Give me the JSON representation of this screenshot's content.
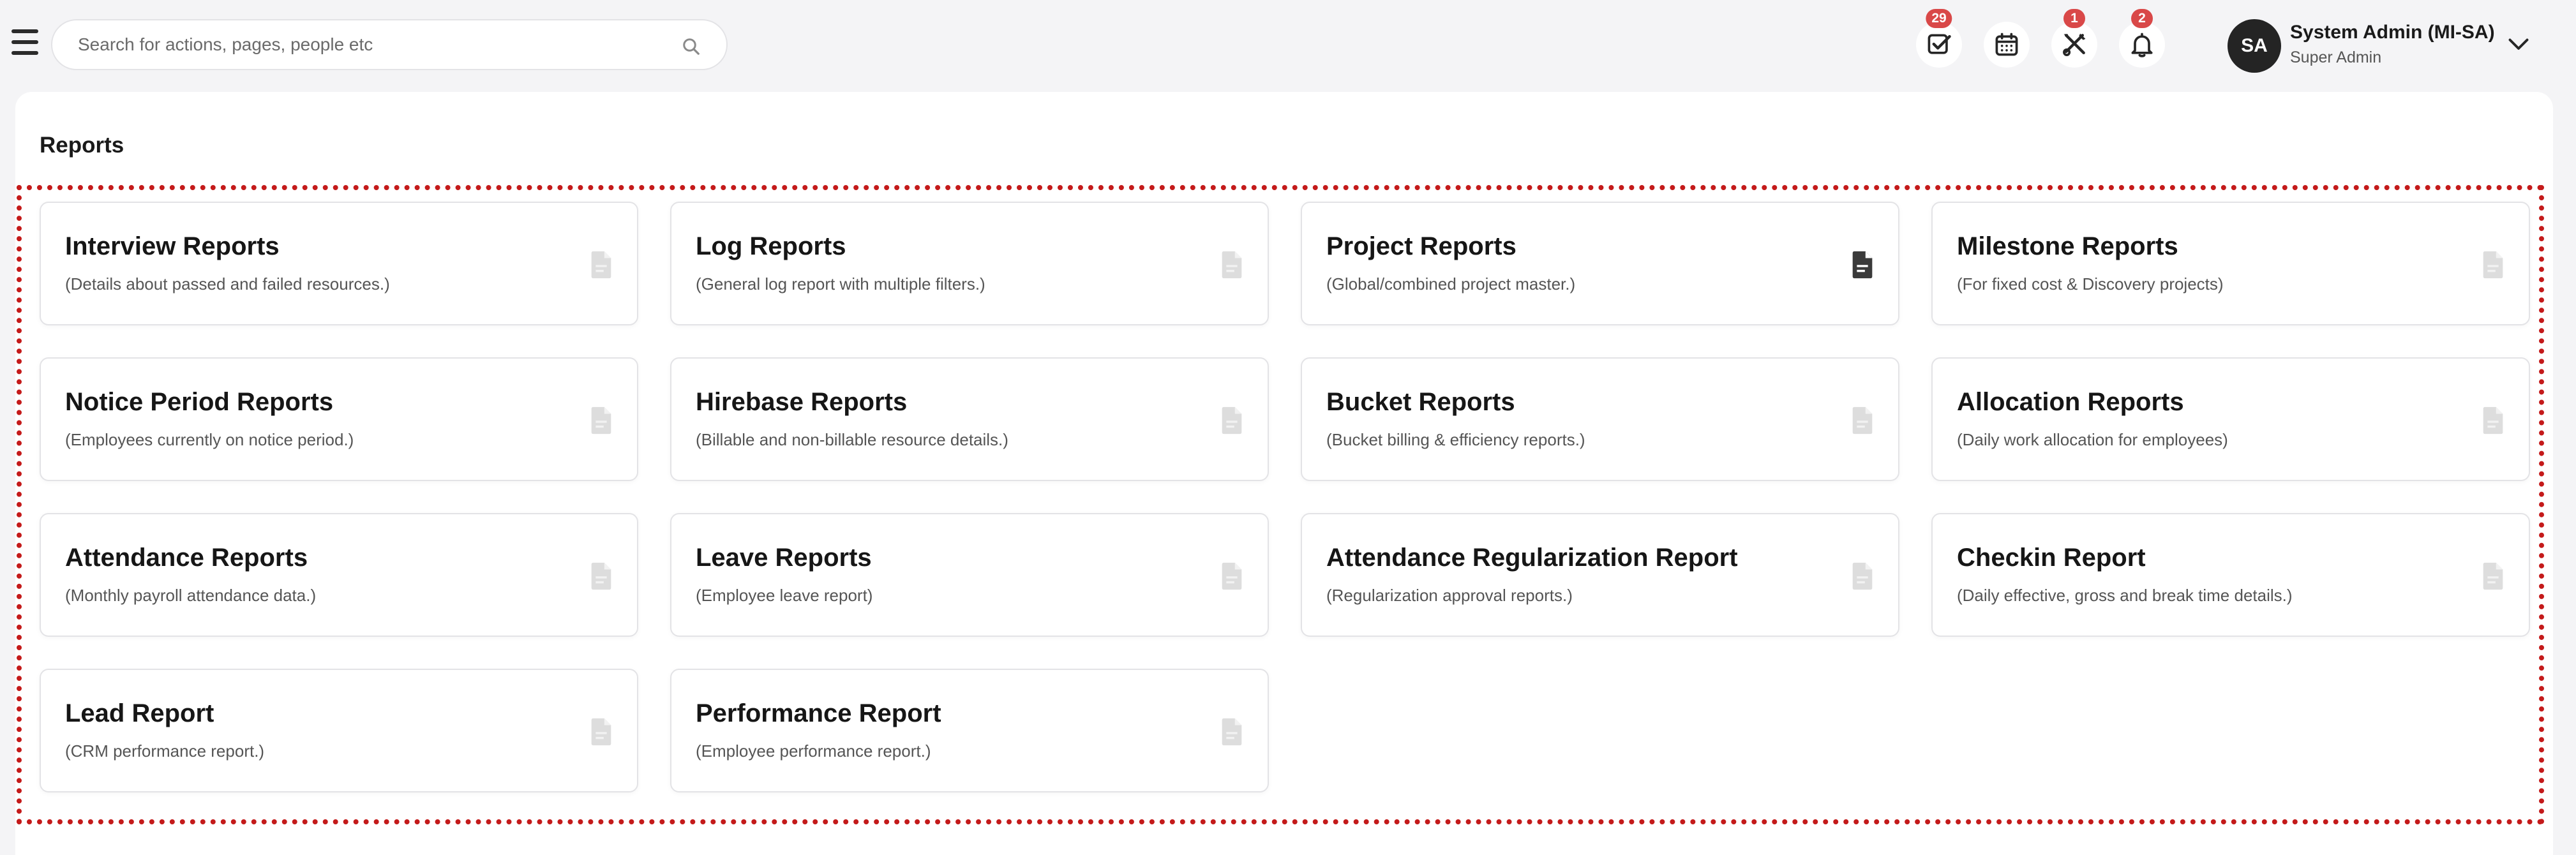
{
  "search": {
    "placeholder": "Search for actions, pages, people etc"
  },
  "header_icons": [
    {
      "name": "tasks-icon",
      "badge": "29"
    },
    {
      "name": "calendar-icon",
      "badge": ""
    },
    {
      "name": "tools-icon",
      "badge": "1"
    },
    {
      "name": "bell-icon",
      "badge": "2"
    }
  ],
  "user": {
    "initials": "SA",
    "name": "System Admin (MI-SA)",
    "role": "Super Admin"
  },
  "page": {
    "title": "Reports"
  },
  "reports": [
    {
      "title": "Interview Reports",
      "desc": "(Details about passed and failed resources.)",
      "active": false
    },
    {
      "title": "Log Reports",
      "desc": "(General log report with multiple filters.)",
      "active": false
    },
    {
      "title": "Project Reports",
      "desc": "(Global/combined project master.)",
      "active": true
    },
    {
      "title": "Milestone Reports",
      "desc": "(For fixed cost & Discovery projects)",
      "active": false
    },
    {
      "title": "Notice Period Reports",
      "desc": "(Employees currently on notice period.)",
      "active": false
    },
    {
      "title": "Hirebase Reports",
      "desc": "(Billable and non-billable resource details.)",
      "active": false
    },
    {
      "title": "Bucket Reports",
      "desc": "(Bucket billing & efficiency reports.)",
      "active": false
    },
    {
      "title": "Allocation Reports",
      "desc": "(Daily work allocation for employees)",
      "active": false
    },
    {
      "title": "Attendance Reports",
      "desc": "(Monthly payroll attendance data.)",
      "active": false
    },
    {
      "title": "Leave Reports",
      "desc": "(Employee leave report)",
      "active": false
    },
    {
      "title": "Attendance Regularization Report",
      "desc": "(Regularization approval reports.)",
      "active": false
    },
    {
      "title": "Checkin Report",
      "desc": "(Daily effective, gross and break time details.)",
      "active": false
    },
    {
      "title": "Lead Report",
      "desc": "(CRM performance report.)",
      "active": false
    },
    {
      "title": "Performance Report",
      "desc": "(Employee performance report.)",
      "active": false
    }
  ],
  "colors": {
    "accent": "#d94848",
    "highlight_border": "#c41a1a",
    "icon_active": "#3a3a3a",
    "icon_inactive": "#dddddd"
  }
}
